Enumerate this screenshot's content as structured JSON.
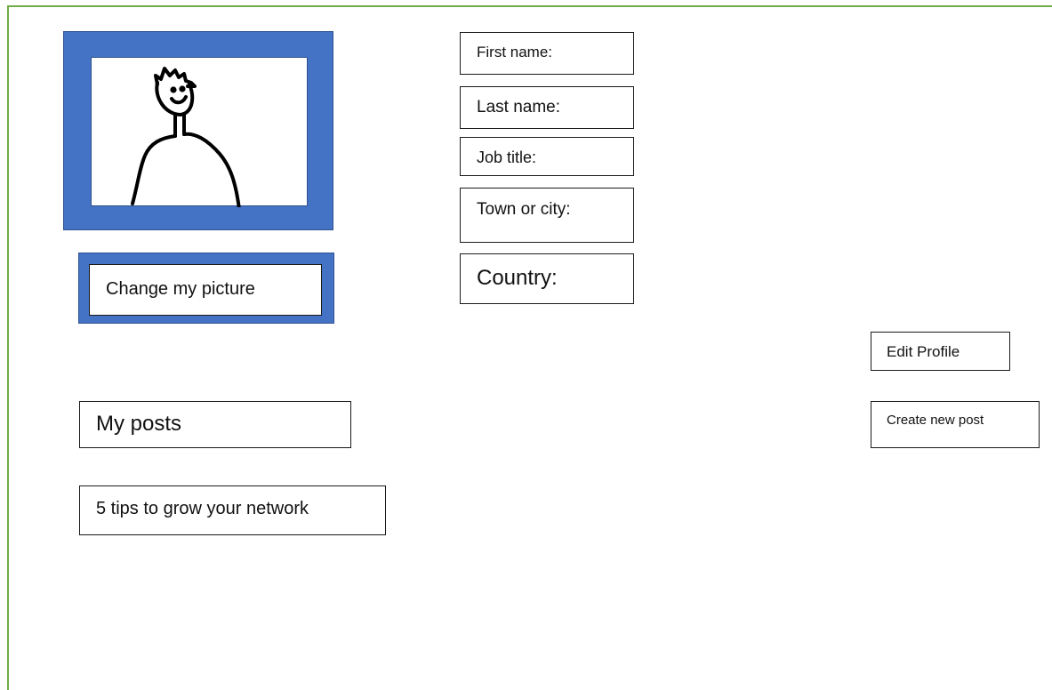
{
  "profile": {
    "change_picture_label": "Change my picture",
    "fields": {
      "first_name": "First name:",
      "last_name": "Last name:",
      "job_title": "Job title:",
      "town_or_city": "Town or city:",
      "country": "Country:"
    }
  },
  "actions": {
    "edit_profile": "Edit Profile",
    "create_new_post": "Create new post"
  },
  "posts": {
    "heading": "My posts",
    "items": [
      "5 tips to grow your network"
    ]
  },
  "colors": {
    "frame_border": "#70ad47",
    "picture_frame": "#4472c4"
  },
  "icons": {
    "avatar": "stick-figure-avatar"
  }
}
